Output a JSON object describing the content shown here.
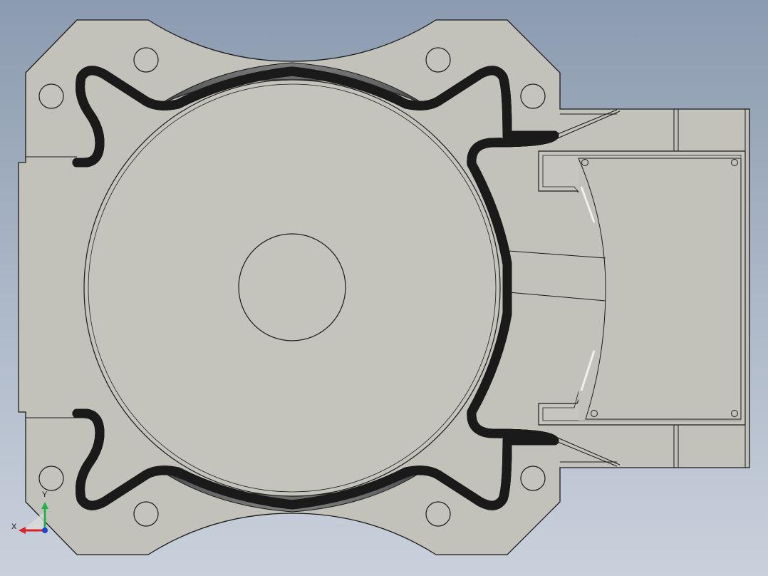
{
  "viewport": {
    "background_top": "#8c9bb0",
    "background_bottom": "#c9d1dc",
    "part_fill": "#c2c2ba",
    "edge_color": "#1a1a1a",
    "shadow_color": "#55575a"
  },
  "triad": {
    "x_label": "X",
    "y_label": "Y",
    "x_color": "#d8232a",
    "y_color": "#22b14c",
    "z_color": "#2244cc"
  }
}
